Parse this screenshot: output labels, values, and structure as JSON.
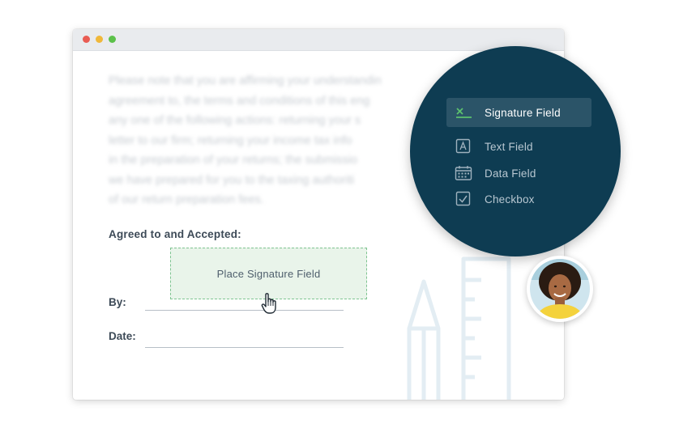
{
  "document": {
    "blurred_paragraph": "Please note that you are affirming your understandin\nagreement to, the terms and conditions of this eng\nany one of the following actions: returning your s\nletter to our firm; returning your income tax info\nin the preparation of your returns; the submissio\nwe have prepared for you to the taxing authoriti\nof our return preparation fees.",
    "agreed_label": "Agreed to and Accepted:",
    "signature_placeholder": "Place Signature Field",
    "by_label": "By:",
    "date_label": "Date:"
  },
  "field_menu": {
    "items": [
      {
        "label": "Signature Field",
        "icon": "signature-icon",
        "active": true
      },
      {
        "label": "Text Field",
        "icon": "text-field-icon",
        "active": false
      },
      {
        "label": "Data Field",
        "icon": "calendar-icon",
        "active": false
      },
      {
        "label": "Checkbox",
        "icon": "checkbox-icon",
        "active": false
      }
    ]
  },
  "colors": {
    "menu_bg": "#0e3c52",
    "menu_active": "#2b5468",
    "accent_green": "#5cc16e",
    "signature_box_bg": "#e9f4ea",
    "signature_box_border": "#7fc491"
  }
}
